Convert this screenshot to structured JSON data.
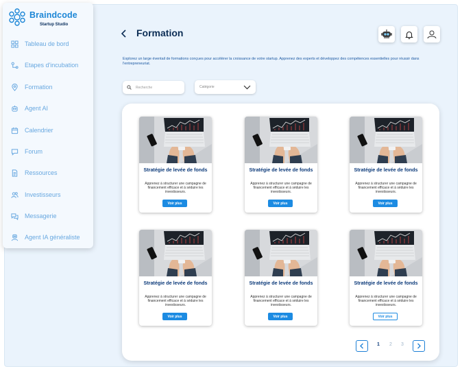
{
  "brand": {
    "title": "Braindcode",
    "subtitle": "Startup Studio"
  },
  "sidebar": {
    "items": [
      {
        "label": "Tableau de bord",
        "icon": "grid-icon"
      },
      {
        "label": "Etapes d'incubation",
        "icon": "steps-icon"
      },
      {
        "label": "Formation",
        "icon": "location-pin-icon"
      },
      {
        "label": "Agent AI",
        "icon": "robot-icon"
      },
      {
        "label": "Calendrier",
        "icon": "calendar-icon"
      },
      {
        "label": "Forum",
        "icon": "chat-icon"
      },
      {
        "label": "Ressources",
        "icon": "document-icon"
      },
      {
        "label": "Investisseurs",
        "icon": "people-icon"
      },
      {
        "label": "Messagerie",
        "icon": "messages-icon"
      },
      {
        "label": "Agent IA généraliste",
        "icon": "robot-user-icon"
      }
    ]
  },
  "header": {
    "title": "Formation"
  },
  "intro": "Explorez un large éventail de formations conçues pour accélérer la croissance de votre startup. Apprenez des experts et développez des compétences essentielles pour réussir dans l'entrepreneuriat.",
  "filters": {
    "search_placeholder": "Recherche",
    "category_placeholder": "Catégorie"
  },
  "cards": [
    {
      "title": "Stratégie de levée de fonds",
      "description": "Apprenez à structurer une campagne de financement efficace et à séduire les investisseurs.",
      "button": "Voir plus",
      "button_style": "filled"
    },
    {
      "title": "Stratégie de levée de fonds",
      "description": "Apprenez à structurer une campagne de financement efficace et à séduire les investisseurs.",
      "button": "Voir plus",
      "button_style": "filled"
    },
    {
      "title": "Stratégie de levée de fonds",
      "description": "Apprenez à structurer une campagne de financement efficace et à séduire les investisseurs.",
      "button": "Voir plus",
      "button_style": "filled"
    },
    {
      "title": "Stratégie de levée de fonds",
      "description": "Apprenez à structurer une campagne de financement efficace et à séduire les investisseurs.",
      "button": "Voir plus",
      "button_style": "filled"
    },
    {
      "title": "Stratégie de levée de fonds",
      "description": "Apprenez à structurer une campagne de financement efficace et à séduire les investisseurs.",
      "button": "Voir plus",
      "button_style": "filled"
    },
    {
      "title": "Stratégie de levée de fonds",
      "description": "Apprenez à structurer une campagne de financement efficace et à séduire les investisseurs.",
      "button": "Voir plus",
      "button_style": "outline"
    }
  ],
  "pagination": {
    "pages": [
      "1",
      "2",
      "3"
    ],
    "current": "1"
  },
  "colors": {
    "accent": "#1c8be2",
    "title": "#0c2d55",
    "nav": "#68a8e0",
    "background": "#eaf3fc"
  }
}
